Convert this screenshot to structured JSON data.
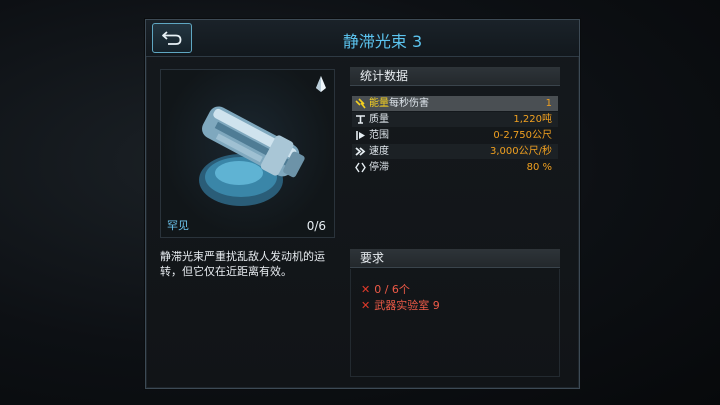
{
  "header": {
    "title": "静滞光束 3",
    "back_icon": "back-arrow-icon"
  },
  "item": {
    "rarity_label": "罕见",
    "count": "0/6",
    "rarity_icon": "crystal-icon",
    "description": "静滞光束严重扰乱敌人发动机的运转，但它仅在近距离有效。"
  },
  "stats": {
    "heading": "统计数据",
    "rows": [
      {
        "icon": "energy-icon",
        "name_highlight": "能量",
        "name": "每秒伤害",
        "value": "1"
      },
      {
        "icon": "mass-icon",
        "name_highlight": "",
        "name": "质量",
        "value": "1,220吨"
      },
      {
        "icon": "range-icon",
        "name_highlight": "",
        "name": "范围",
        "value": "0-2,750公尺"
      },
      {
        "icon": "speed-icon",
        "name_highlight": "",
        "name": "速度",
        "value": "3,000公尺/秒"
      },
      {
        "icon": "stasis-icon",
        "name_highlight": "",
        "name": "停滞",
        "value": "80 %"
      }
    ]
  },
  "requirements": {
    "heading": "要求",
    "items": [
      {
        "icon": "cross-icon",
        "text": "0 / 6个"
      },
      {
        "icon": "cross-icon",
        "text": "武器实验室 9"
      }
    ]
  },
  "colors": {
    "accent": "#5cc4ef",
    "value": "#f0a020",
    "error": "#ee5a47",
    "highlight": "#f5d020"
  }
}
